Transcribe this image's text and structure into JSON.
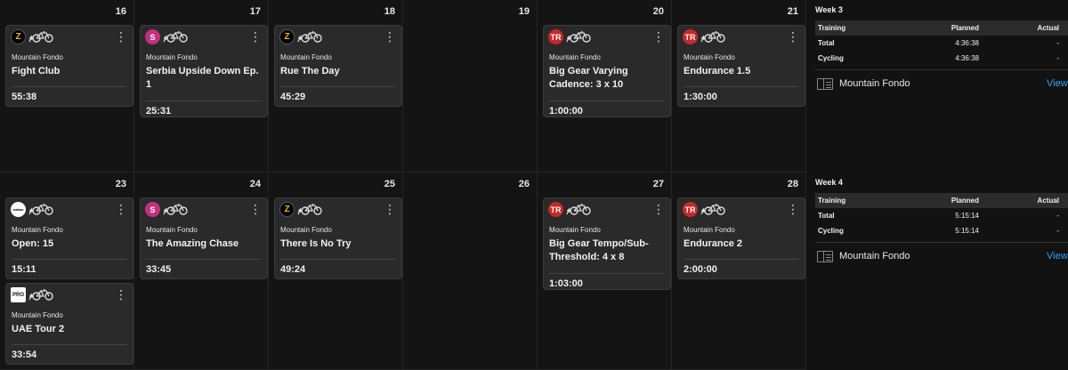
{
  "weeks": [
    {
      "days": [
        {
          "num": "16",
          "cards": [
            {
              "badge": "zwift",
              "badge_text": "Z",
              "plan": "Mountain Fondo",
              "title": "Fight Club",
              "duration": "55:38"
            }
          ]
        },
        {
          "num": "17",
          "cards": [
            {
              "badge": "sufferfest",
              "badge_text": "S",
              "plan": "Mountain Fondo",
              "title": "Serbia Upside Down Ep. 1",
              "duration": "25:31"
            }
          ]
        },
        {
          "num": "18",
          "cards": [
            {
              "badge": "zwift",
              "badge_text": "Z",
              "plan": "Mountain Fondo",
              "title": "Rue The Day",
              "duration": "45:29"
            }
          ]
        },
        {
          "num": "19",
          "cards": []
        },
        {
          "num": "20",
          "cards": [
            {
              "badge": "red",
              "badge_text": "TR",
              "plan": "Mountain Fondo",
              "title": "Big Gear Varying Cadence: 3 x 10",
              "duration": "1:00:00"
            }
          ]
        },
        {
          "num": "21",
          "cards": [
            {
              "badge": "red",
              "badge_text": "TR",
              "plan": "Mountain Fondo",
              "title": "Endurance 1.5",
              "duration": "1:30:00"
            }
          ]
        }
      ],
      "summary": {
        "label": "Week 3",
        "headers": [
          "Training",
          "Planned",
          "Actual"
        ],
        "rows": [
          {
            "label": "Total",
            "planned": "4:36:38",
            "actual": "-"
          },
          {
            "label": "Cycling",
            "planned": "4:36:38",
            "actual": "-"
          }
        ],
        "plan_name": "Mountain Fondo",
        "view_label": "View"
      }
    },
    {
      "days": [
        {
          "num": "23",
          "cards": [
            {
              "badge": "wahoo",
              "badge_text": "wahoo",
              "plan": "Mountain Fondo",
              "title": "Open: 15",
              "duration": "15:11"
            },
            {
              "badge": "pro",
              "badge_text": "PRO",
              "plan": "Mountain Fondo",
              "title": "UAE Tour 2",
              "duration": "33:54"
            }
          ]
        },
        {
          "num": "24",
          "cards": [
            {
              "badge": "sufferfest",
              "badge_text": "S",
              "plan": "Mountain Fondo",
              "title": "The Amazing Chase",
              "duration": "33:45"
            }
          ]
        },
        {
          "num": "25",
          "cards": [
            {
              "badge": "zwift",
              "badge_text": "Z",
              "plan": "Mountain Fondo",
              "title": "There Is No Try",
              "duration": "49:24"
            }
          ]
        },
        {
          "num": "26",
          "cards": []
        },
        {
          "num": "27",
          "cards": [
            {
              "badge": "red",
              "badge_text": "TR",
              "plan": "Mountain Fondo",
              "title": "Big Gear Tempo/Sub-Threshold: 4 x 8",
              "duration": "1:03:00"
            }
          ]
        },
        {
          "num": "28",
          "cards": [
            {
              "badge": "red",
              "badge_text": "TR",
              "plan": "Mountain Fondo",
              "title": "Endurance 2",
              "duration": "2:00:00"
            }
          ]
        }
      ],
      "summary": {
        "label": "Week 4",
        "headers": [
          "Training",
          "Planned",
          "Actual"
        ],
        "rows": [
          {
            "label": "Total",
            "planned": "5:15:14",
            "actual": "-"
          },
          {
            "label": "Cycling",
            "planned": "5:15:14",
            "actual": "-"
          }
        ],
        "plan_name": "Mountain Fondo",
        "view_label": "View"
      }
    }
  ],
  "icons": {
    "bike": "bike-icon",
    "menu": "more-vertical-icon",
    "plan": "book-icon"
  },
  "colors": {
    "background": "#121212",
    "card": "#2a2a2a",
    "link": "#2da1ff",
    "trainerroad": "#c62828",
    "sufferfest": "#c4317f",
    "zwift_accent": "#f3b800"
  }
}
